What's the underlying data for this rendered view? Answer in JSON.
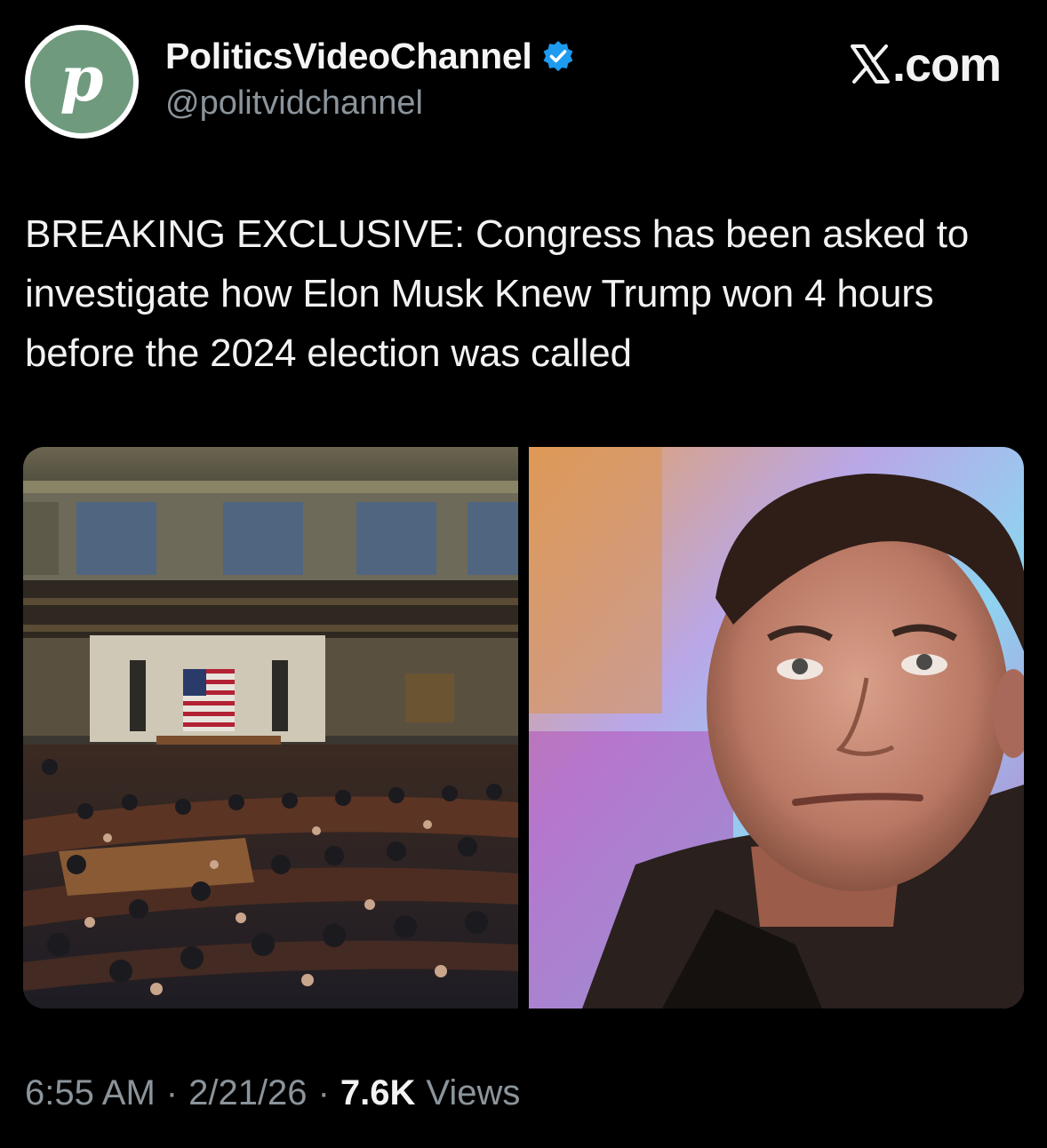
{
  "account": {
    "avatar_letter": "p",
    "display_name": "PoliticsVideoChannel",
    "handle": "@politvidchannel",
    "verified": true
  },
  "brand": {
    "label": ".com",
    "icon": "x-logo-icon"
  },
  "tweet": {
    "text": "BREAKING EXCLUSIVE: Congress has been asked to investigate how Elon Musk Knew Trump won 4 hours before the 2024 election was called"
  },
  "media": {
    "left_icon": "photo-congress-chamber",
    "right_icon": "photo-portrait"
  },
  "meta": {
    "time": "6:55 AM",
    "date": "2/21/26",
    "views_count": "7.6K",
    "views_label": "Views"
  },
  "colors": {
    "background": "#000000",
    "text_primary": "#e7e9ea",
    "text_secondary": "#8b949b",
    "verified_blue": "#1d9bf0",
    "avatar_green": "#6f9a7e"
  }
}
